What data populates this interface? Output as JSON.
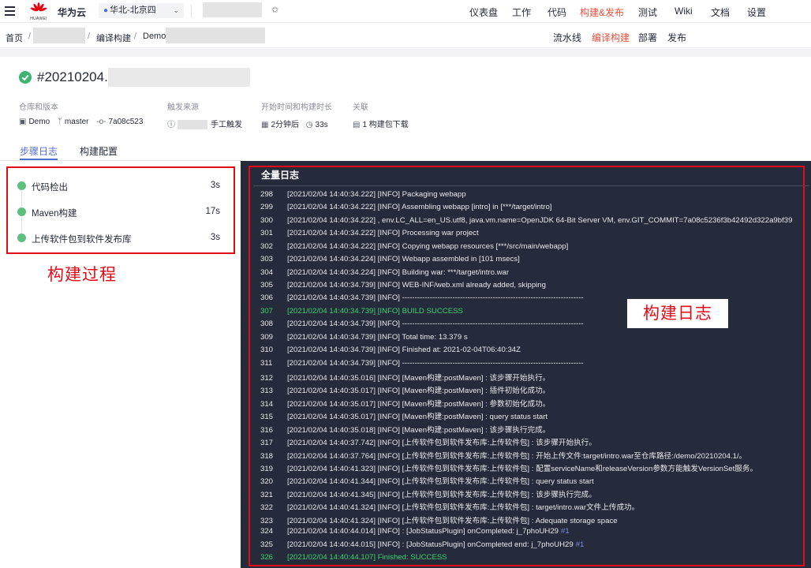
{
  "topbar": {
    "brand": "华为云",
    "logo_word": "HUAWEI",
    "region": "华北-北京四",
    "nav": [
      "仪表盘",
      "工作",
      "代码",
      "构建&发布",
      "测试",
      "Wiki",
      "文档",
      "设置"
    ],
    "active_nav": "构建&发布"
  },
  "breadcrumb": {
    "home": "首页",
    "section": "编译构建",
    "job_prefix": "Demo-",
    "subnav": [
      "流水线",
      "编译构建",
      "部署",
      "发布"
    ],
    "active_subnav": "编译构建"
  },
  "build": {
    "number": "#20210204.1",
    "status": "success",
    "repo_label": "仓库和版本",
    "repo": "Demo",
    "branch": "master",
    "commit": "7a08c523",
    "trigger_label": "触发来源",
    "trigger": "手工触发",
    "time_label": "开始时间和构建时长",
    "start": "2分钟后",
    "duration": "33s",
    "related_label": "关联",
    "related": "1 构建包下载"
  },
  "tabs": [
    "步骤日志",
    "构建配置"
  ],
  "active_tab": "步骤日志",
  "steps": [
    {
      "name": "代码检出",
      "duration": "3s"
    },
    {
      "name": "Maven构建",
      "duration": "17s"
    },
    {
      "name": "上传软件包到软件发布库",
      "duration": "3s"
    }
  ],
  "annotations": {
    "steps_label": "构建过程",
    "log_label": "构建日志"
  },
  "log": {
    "title": "全量日志",
    "lines": [
      {
        "n": "298",
        "text": "[2021/02/04 14:40:34.222] [INFO] Packaging webapp"
      },
      {
        "n": "299",
        "text": "[2021/02/04 14:40:34.222] [INFO] Assembling webapp [intro] in [***/target/intro]"
      },
      {
        "n": "300",
        "text": "[2021/02/04 14:40:34.222] , env.LC_ALL=en_US.utf8, java.vm.name=OpenJDK 64-Bit Server VM, env.GIT_COMMIT=7a08c5236f3b42492d322a9bf39"
      },
      {
        "n": "301",
        "text": "[2021/02/04 14:40:34.222] [INFO] Processing war project"
      },
      {
        "n": "302",
        "text": "[2021/02/04 14:40:34.222] [INFO] Copying webapp resources [***/src/main/webapp]"
      },
      {
        "n": "303",
        "text": "[2021/02/04 14:40:34.224] [INFO] Webapp assembled in [101 msecs]"
      },
      {
        "n": "304",
        "text": "[2021/02/04 14:40:34.224] [INFO] Building war: ***/target/intro.war"
      },
      {
        "n": "305",
        "text": "[2021/02/04 14:40:34.739] [INFO] WEB-INF/web.xml already added, skipping"
      },
      {
        "n": "306",
        "text": "[2021/02/04 14:40:34.739] [INFO] ------------------------------------------------------------------------"
      },
      {
        "n": "307",
        "text": "[2021/02/04 14:40:34.739] [INFO] BUILD SUCCESS",
        "green": true
      },
      {
        "n": "308",
        "text": "[2021/02/04 14:40:34.739] [INFO] ------------------------------------------------------------------------"
      },
      {
        "n": "309",
        "text": "[2021/02/04 14:40:34.739] [INFO] Total time: 13.379 s"
      },
      {
        "n": "310",
        "text": "[2021/02/04 14:40:34.739] [INFO] Finished at: 2021-02-04T06:40:34Z"
      },
      {
        "n": "311",
        "text": "[2021/02/04 14:40:34.739] [INFO] ------------------------------------------------------------------------"
      },
      {
        "n": "312",
        "text": "[2021/02/04 14:40:35.016] [INFO] [Maven构建:postMaven] : 该步骤开始执行。"
      },
      {
        "n": "313",
        "text": "[2021/02/04 14:40:35.017] [INFO] [Maven构建:postMaven] : 插件初始化成功。"
      },
      {
        "n": "314",
        "text": "[2021/02/04 14:40:35.017] [INFO] [Maven构建:postMaven] : 参数初始化成功。"
      },
      {
        "n": "315",
        "text": "[2021/02/04 14:40:35.017] [INFO] [Maven构建:postMaven] : query status start"
      },
      {
        "n": "316",
        "text": "[2021/02/04 14:40:35.018] [INFO] [Maven构建:postMaven] : 该步骤执行完成。"
      },
      {
        "n": "317",
        "text": "[2021/02/04 14:40:37.742] [INFO] [上传软件包到软件发布库:上传软件包] : 该步骤开始执行。"
      },
      {
        "n": "318",
        "text": "[2021/02/04 14:40:37.764] [INFO] [上传软件包到软件发布库:上传软件包] : 开始上传文件:target/intro.war至仓库路径:/demo/20210204.1/。"
      },
      {
        "n": "319",
        "text": "[2021/02/04 14:40:41.323] [INFO] [上传软件包到软件发布库:上传软件包] : 配置serviceName和releaseVersion参数方能触发VersionSet服务。"
      },
      {
        "n": "320",
        "text": "[2021/02/04 14:40:41.344] [INFO] [上传软件包到软件发布库:上传软件包] : query status start"
      },
      {
        "n": "321",
        "text": "[2021/02/04 14:40:41.345] [INFO] [上传软件包到软件发布库:上传软件包] : 该步骤执行完成。"
      },
      {
        "n": "322",
        "text": "[2021/02/04 14:40:41.324] [INFO] [上传软件包到软件发布库:上传软件包] : target/intro.war文件上传成功。"
      },
      {
        "n": "323",
        "text": "[2021/02/04 14:40:41.324] [INFO] [上传软件包到软件发布库:上传软件包] : Adequate storage space"
      },
      {
        "n": "324",
        "text": "[2021/02/04 14:40:44.014] [INFO] : [JobStatusPlugin] onCompleted: j_7phoUH29",
        "tag": "#1"
      },
      {
        "n": "325",
        "text": "[2021/02/04 14:40:44.015] [INFO] : [JobStatusPlugin] onCompleted end: j_7phoUH29",
        "tag": "#1"
      },
      {
        "n": "326",
        "text": "[2021/02/04 14:40:44.107] Finished: SUCCESS",
        "green": true
      }
    ]
  },
  "colors": {
    "accent": "#526ecc",
    "active_nav": "#e84e3c",
    "success": "#3cb371",
    "annotation_red": "#e30b17",
    "log_bg": "#252b3a",
    "log_success": "#3cd26e"
  },
  "icons": [
    "menu-icon",
    "huawei-logo",
    "location-pin-icon",
    "chevron-down-icon",
    "star-icon",
    "success-check-icon",
    "repo-icon",
    "branch-icon",
    "commit-icon",
    "trigger-icon",
    "calendar-icon",
    "clock-icon",
    "package-icon"
  ]
}
